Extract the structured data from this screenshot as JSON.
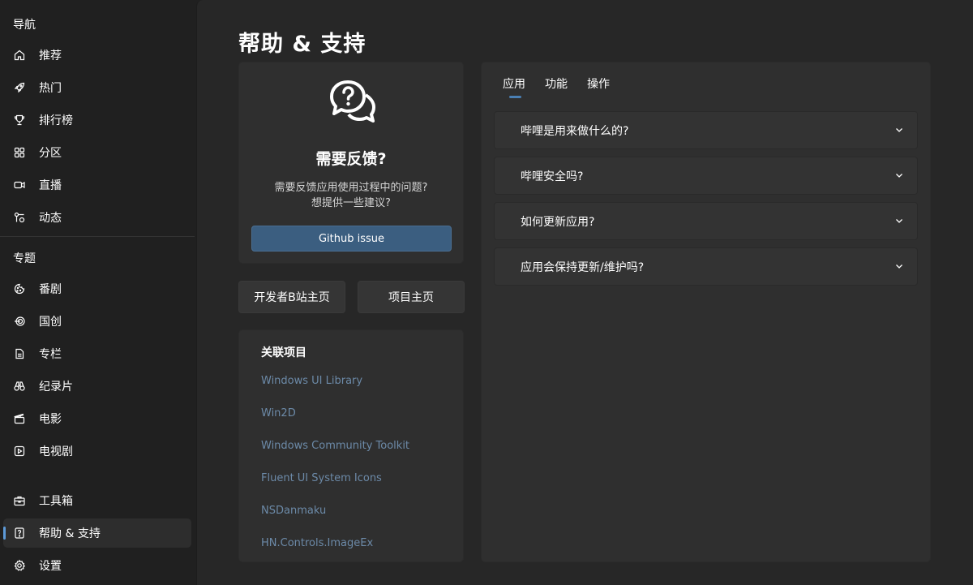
{
  "sidebar": {
    "nav_header": "导航",
    "topic_header": "专题",
    "nav_items": [
      {
        "label": "推荐",
        "icon": "home-icon"
      },
      {
        "label": "热门",
        "icon": "rocket-icon"
      },
      {
        "label": "排行榜",
        "icon": "trophy-icon"
      },
      {
        "label": "分区",
        "icon": "grid-icon"
      },
      {
        "label": "直播",
        "icon": "video-icon"
      },
      {
        "label": "动态",
        "icon": "feed-icon"
      }
    ],
    "topic_items": [
      {
        "label": "番剧",
        "icon": "cookie-icon"
      },
      {
        "label": "国创",
        "icon": "target-icon"
      },
      {
        "label": "专栏",
        "icon": "document-icon"
      },
      {
        "label": "纪录片",
        "icon": "binoculars-icon"
      },
      {
        "label": "电影",
        "icon": "clapper-icon"
      },
      {
        "label": "电视剧",
        "icon": "play-icon"
      }
    ],
    "footer_items": [
      {
        "label": "工具箱",
        "icon": "toolbox-icon"
      },
      {
        "label": "帮助 & 支持",
        "icon": "help-icon",
        "active": true
      },
      {
        "label": "设置",
        "icon": "settings-icon"
      }
    ]
  },
  "page": {
    "title": "帮助 & 支持"
  },
  "feedback": {
    "title": "需要反馈?",
    "desc_line1": "需要反馈应用使用过程中的问题?",
    "desc_line2": "想提供一些建议?",
    "button": "Github issue"
  },
  "links": {
    "dev_home": "开发者B站主页",
    "project_home": "项目主页"
  },
  "related": {
    "title": "关联项目",
    "items": [
      "Windows UI Library",
      "Win2D",
      "Windows Community Toolkit",
      "Fluent UI System Icons",
      "NSDanmaku",
      "HN.Controls.ImageEx"
    ]
  },
  "faq": {
    "tabs": [
      "应用",
      "功能",
      "操作"
    ],
    "selected_tab": "应用",
    "questions": [
      "哔哩是用来做什么的?",
      "哔哩安全吗?",
      "如何更新应用?",
      "应用会保持更新/维护吗?"
    ]
  },
  "colors": {
    "accent": "#5d9ad8",
    "button": "#3b5e80",
    "link": "#6c8aa8",
    "background": "#202020",
    "card": "#2f2f2f"
  }
}
